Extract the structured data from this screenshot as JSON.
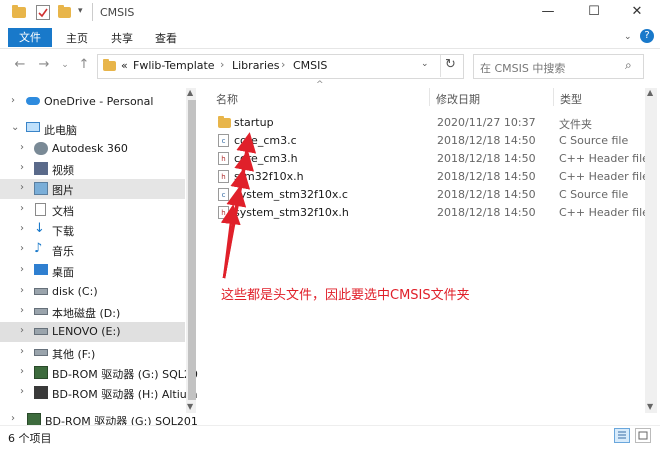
{
  "window": {
    "title": "CMSIS"
  },
  "ribbon": {
    "tabs": [
      "文件",
      "主页",
      "共享",
      "查看"
    ]
  },
  "address": {
    "crumbs": [
      "«",
      "Fwlib-Template",
      "Libraries",
      "CMSIS"
    ]
  },
  "search": {
    "placeholder": "在 CMSIS 中搜索"
  },
  "nav": {
    "items": [
      {
        "label": "OneDrive - Personal",
        "icon": "cloud-icon"
      },
      {
        "label": "此电脑",
        "icon": "computer-icon"
      },
      {
        "label": "Autodesk 360",
        "icon": "autodesk-icon"
      },
      {
        "label": "视频",
        "icon": "video-icon"
      },
      {
        "label": "图片",
        "icon": "picture-icon"
      },
      {
        "label": "文档",
        "icon": "document-icon"
      },
      {
        "label": "下载",
        "icon": "download-icon"
      },
      {
        "label": "音乐",
        "icon": "music-icon"
      },
      {
        "label": "桌面",
        "icon": "desktop-icon"
      },
      {
        "label": "disk (C:)",
        "icon": "drive-icon"
      },
      {
        "label": "本地磁盘 (D:)",
        "icon": "drive-icon"
      },
      {
        "label": "LENOVO (E:)",
        "icon": "drive-icon"
      },
      {
        "label": "其他 (F:)",
        "icon": "drive-icon"
      },
      {
        "label": "BD-ROM 驱动器 (G:) SQL20",
        "icon": "disc-icon"
      },
      {
        "label": "BD-ROM 驱动器 (H:) Altium",
        "icon": "disc-icon"
      },
      {
        "label": "BD-ROM 驱动器 (G:) SQL201",
        "icon": "disc-icon"
      }
    ]
  },
  "columns": {
    "name": "名称",
    "date": "修改日期",
    "type": "类型"
  },
  "files": [
    {
      "name": "startup",
      "date": "2020/11/27 10:37",
      "type": "文件夹",
      "icon": "folder-icon"
    },
    {
      "name": "core_cm3.c",
      "date": "2018/12/18 14:50",
      "type": "C Source file",
      "icon": "c-file-icon"
    },
    {
      "name": "core_cm3.h",
      "date": "2018/12/18 14:50",
      "type": "C++ Header file",
      "icon": "h-file-icon"
    },
    {
      "name": "stm32f10x.h",
      "date": "2018/12/18 14:50",
      "type": "C++ Header file",
      "icon": "h-file-icon"
    },
    {
      "name": "system_stm32f10x.c",
      "date": "2018/12/18 14:50",
      "type": "C Source file",
      "icon": "c-file-icon"
    },
    {
      "name": "system_stm32f10x.h",
      "date": "2018/12/18 14:50",
      "type": "C++ Header file",
      "icon": "h-file-icon"
    }
  ],
  "annotation": "这些都是头文件，因此要选中CMSIS文件夹",
  "status": {
    "count": "6 个项目"
  },
  "colors": {
    "accent": "#1979ca",
    "annotation": "#e0202a",
    "selected_nav": "#cce8ff",
    "hover_nav": "#e5e5e5"
  }
}
